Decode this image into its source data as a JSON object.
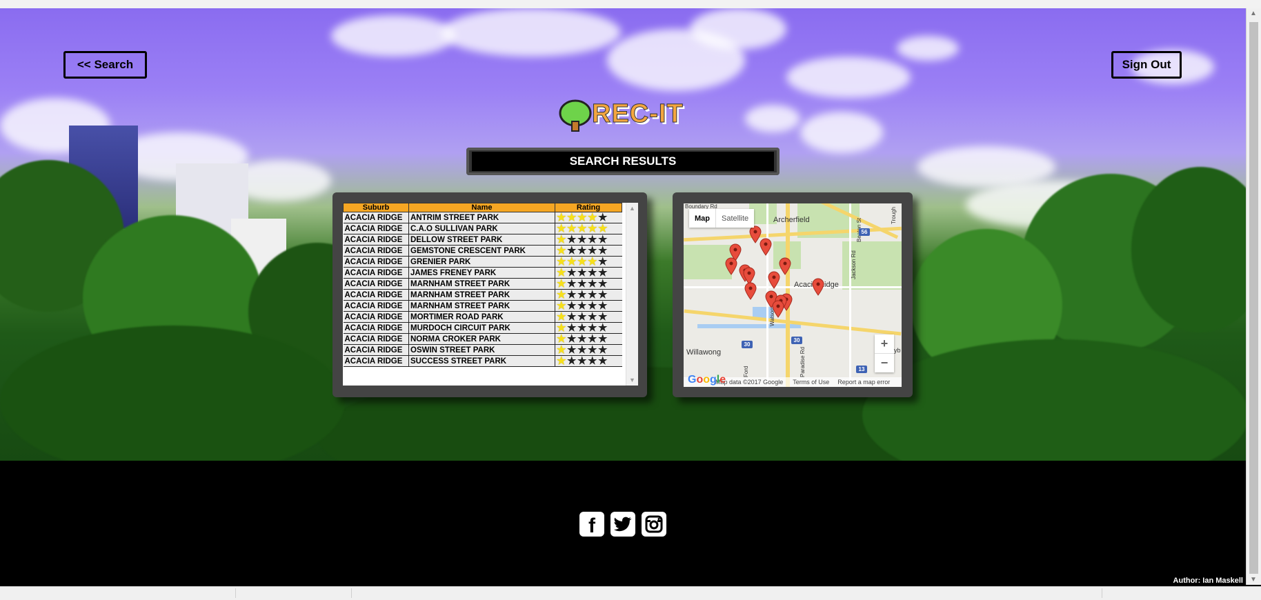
{
  "nav": {
    "back_label": "<< Search",
    "signout_label": "Sign Out"
  },
  "logo": {
    "text": "REC-IT"
  },
  "results": {
    "title": "SEARCH RESULTS"
  },
  "table": {
    "headers": [
      "Suburb",
      "Name",
      "Rating"
    ],
    "rows": [
      {
        "suburb": "ACACIA RIDGE",
        "name": "ANTRIM STREET PARK",
        "rating": 4
      },
      {
        "suburb": "ACACIA RIDGE",
        "name": "C.A.O SULLIVAN PARK",
        "rating": 5
      },
      {
        "suburb": "ACACIA RIDGE",
        "name": "DELLOW STREET PARK",
        "rating": 1
      },
      {
        "suburb": "ACACIA RIDGE",
        "name": "GEMSTONE CRESCENT PARK",
        "rating": 1
      },
      {
        "suburb": "ACACIA RIDGE",
        "name": "GRENIER PARK",
        "rating": 4
      },
      {
        "suburb": "ACACIA RIDGE",
        "name": "JAMES FRENEY PARK",
        "rating": 1
      },
      {
        "suburb": "ACACIA RIDGE",
        "name": "MARNHAM STREET PARK",
        "rating": 1
      },
      {
        "suburb": "ACACIA RIDGE",
        "name": "MARNHAM STREET PARK",
        "rating": 1
      },
      {
        "suburb": "ACACIA RIDGE",
        "name": "MARNHAM STREET PARK",
        "rating": 1
      },
      {
        "suburb": "ACACIA RIDGE",
        "name": "MORTIMER ROAD PARK",
        "rating": 1
      },
      {
        "suburb": "ACACIA RIDGE",
        "name": "MURDOCH CIRCUIT PARK",
        "rating": 1
      },
      {
        "suburb": "ACACIA RIDGE",
        "name": "NORMA CROKER PARK",
        "rating": 1
      },
      {
        "suburb": "ACACIA RIDGE",
        "name": "OSWIN STREET PARK",
        "rating": 1
      },
      {
        "suburb": "ACACIA RIDGE",
        "name": "SUCCESS STREET PARK",
        "rating": 1
      }
    ],
    "max_rating": 5
  },
  "map": {
    "toggle_map": "Map",
    "toggle_satellite": "Satellite",
    "zoom_in": "+",
    "zoom_out": "−",
    "label_archerfield": "Archerfield",
    "label_acacia": "Acacia Ridge",
    "label_willawong": "Willawong",
    "label_jackson": "Jackson Rd",
    "label_watson": "Watson Rd",
    "label_paradise": "Paradise Rd",
    "label_boundary": "Boundary Rd",
    "label_beaton": "Beaton St",
    "label_trough": "Trough",
    "label_ford": "Ford",
    "label_sunnybank": "Sunnyb",
    "shield_30a": "30",
    "shield_30b": "30",
    "shield_56": "56",
    "shield_13": "13",
    "google": "Google",
    "map_data": "Map data ©2017 Google",
    "terms": "Terms of Use",
    "report": "Report a map error"
  },
  "social": {
    "facebook": "f",
    "twitter": "twitter",
    "instagram": "instagram"
  },
  "footer": {
    "author": "Author: Ian Maskell"
  },
  "colors": {
    "header_orange": "#f5a623",
    "star_yellow": "#f7e01a",
    "panel_gray": "#444444",
    "pin_red": "#e74c3c"
  }
}
